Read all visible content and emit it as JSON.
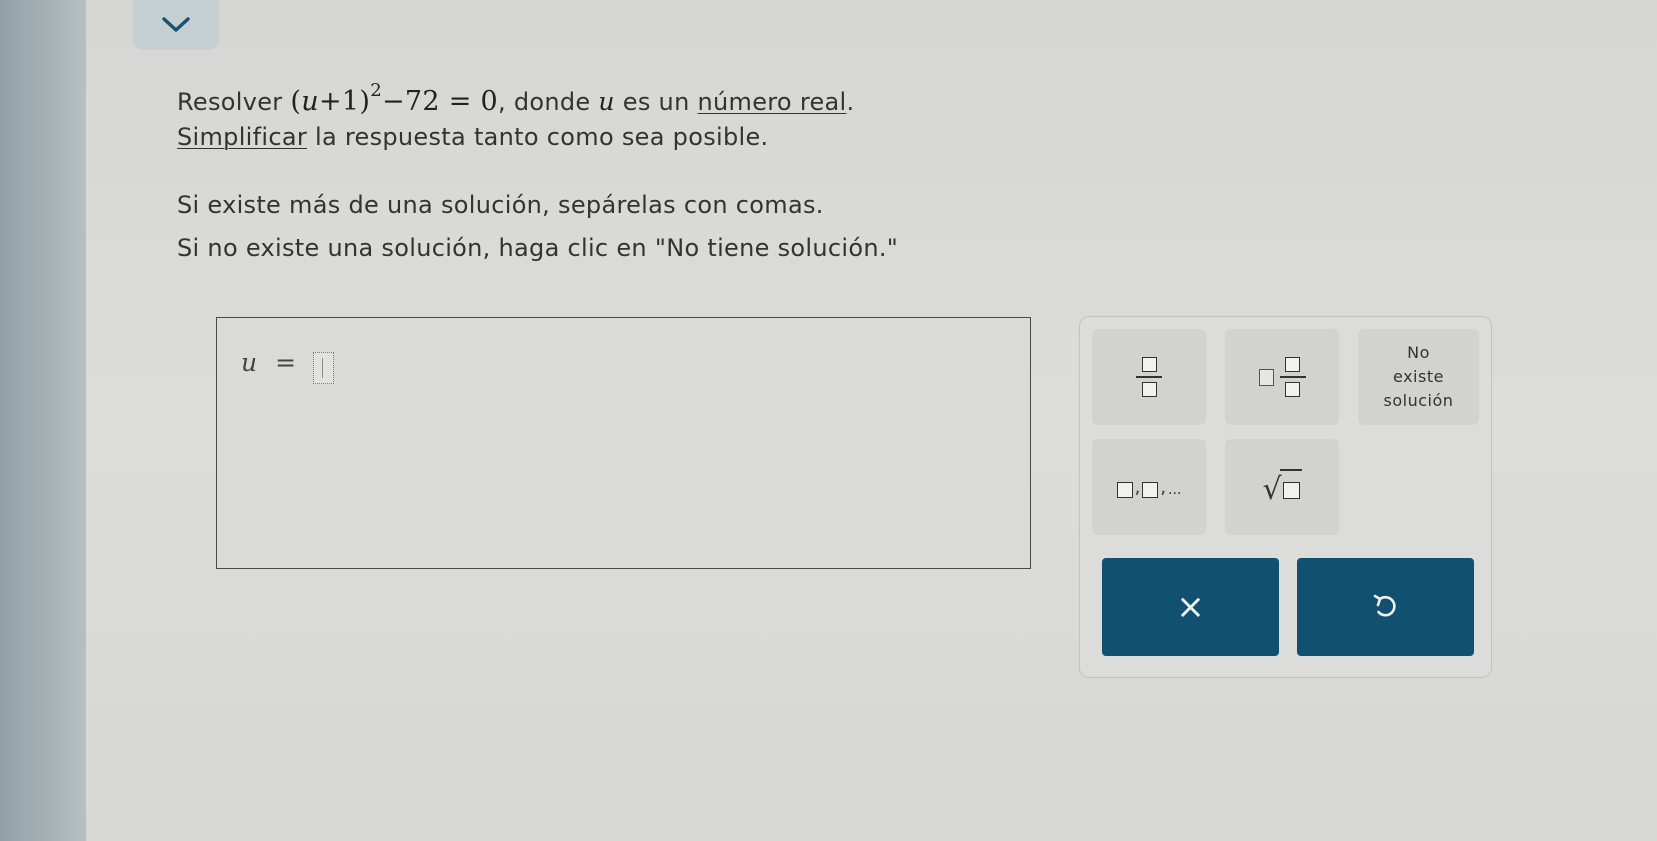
{
  "prompt": {
    "line1_prefix": "Resolver ",
    "equation": {
      "open": "(",
      "variable": "u",
      "plus_one": "+1)",
      "exponent": "2",
      "rest": "−72 = 0"
    },
    "line1_middle": ", donde ",
    "line1_variable": "u",
    "line1_mid2": " es un ",
    "numero_real_link": "número real",
    "line1_end": ".",
    "simplificar_link": "Simplificar",
    "line2_rest": " la respuesta tanto como sea posible.",
    "line3": "Si existe más de una solución, sepárelas con comas.",
    "line4": "Si no existe una solución, haga clic en \"No tiene solución.\""
  },
  "answer": {
    "variable": "u",
    "equals": "=",
    "value": ""
  },
  "keypad": {
    "no_solution_line1": "No",
    "no_solution_line2": "existe",
    "no_solution_line3": "solución",
    "list_separator": ",",
    "list_ellipsis": "...",
    "sqrt_symbol": "√",
    "clear_symbol": "×",
    "undo_symbol": "↺"
  },
  "colors": {
    "action_button": "#11516f",
    "background": "#d9d9d7"
  },
  "icons": {
    "collapse": "chevron-down-icon",
    "clear": "close-icon",
    "undo": "undo-icon"
  }
}
